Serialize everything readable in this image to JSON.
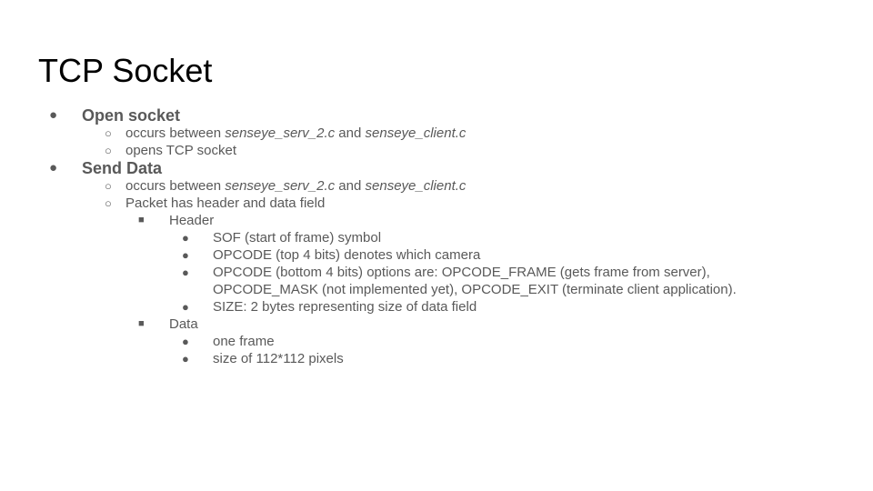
{
  "slide": {
    "title": "TCP Socket",
    "bullets": {
      "level1": "●",
      "level2": "○",
      "level3": "■",
      "level4": "●"
    },
    "open_socket": {
      "heading": "Open socket",
      "item1": {
        "pre": "occurs between ",
        "file1": "senseye_serv_2.c",
        "mid": " and ",
        "file2": "senseye_client.c"
      },
      "item2": "opens TCP socket"
    },
    "send_data": {
      "heading": "Send Data",
      "item1": {
        "pre": "occurs between ",
        "file1": "senseye_serv_2.c",
        "mid": " and ",
        "file2": "senseye_client.c"
      },
      "item2": "Packet has header and data field",
      "header": {
        "label": "Header",
        "items": [
          "SOF (start of frame) symbol",
          "OPCODE (top 4 bits) denotes which camera",
          "OPCODE (bottom 4 bits) options are: OPCODE_FRAME (gets frame from server), OPCODE_MASK (not implemented yet), OPCODE_EXIT (terminate client application).",
          "SIZE: 2 bytes representing size of data field"
        ]
      },
      "data": {
        "label": "Data",
        "items": [
          "one frame",
          "size of 112*112 pixels"
        ]
      }
    }
  }
}
